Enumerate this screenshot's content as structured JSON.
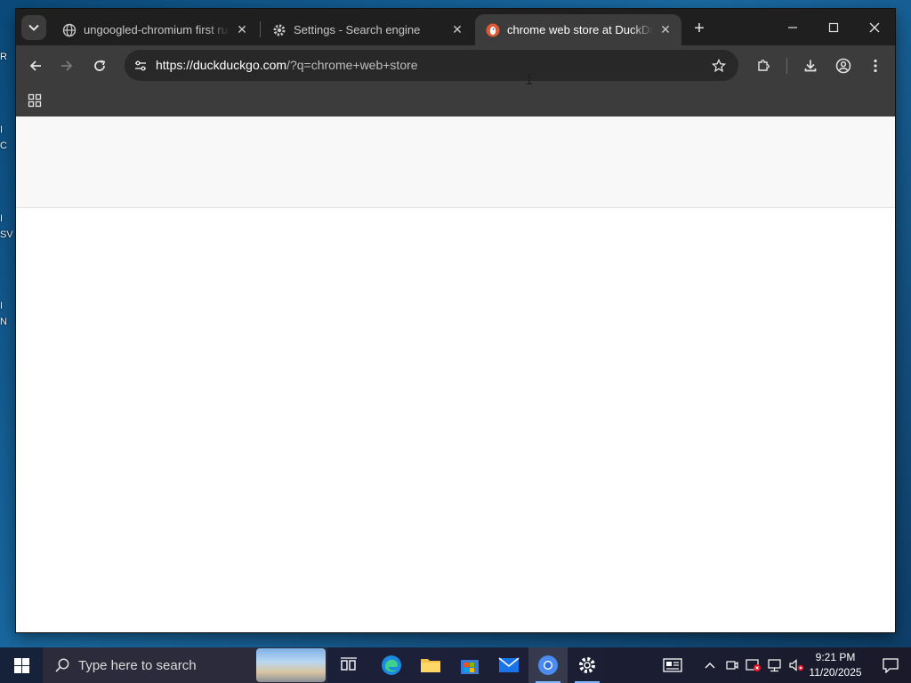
{
  "desktop": {
    "icon_fragments": [
      "R",
      "I",
      "C",
      "I",
      "SV",
      "I",
      "N"
    ]
  },
  "browser": {
    "tabs": [
      {
        "title": "ungoogled-chromium first run p",
        "favicon": "globe-icon",
        "active": false
      },
      {
        "title": "Settings - Search engine",
        "favicon": "gear-icon",
        "active": false
      },
      {
        "title": "chrome web store at DuckDuckGo",
        "favicon": "duckduckgo-icon",
        "active": true
      }
    ],
    "new_tab_label": "+",
    "address_bar": {
      "url_host": "https://duckduckgo.com",
      "url_path": "/?q=chrome+web+store"
    },
    "colors": {
      "tabstrip": "#1f1f1f",
      "toolbar": "#3c3c3c",
      "omnibox": "#282828",
      "content_header": "#f8f8f8",
      "ddg_red": "#de5833"
    }
  },
  "taskbar": {
    "search_placeholder": "Type here to search",
    "apps": [
      "task-view-icon",
      "edge-icon",
      "file-explorer-icon",
      "store-icon",
      "mail-icon",
      "chromium-icon",
      "settings-icon"
    ],
    "clock": {
      "time": "9:21 PM",
      "date": "11/20/2025"
    }
  }
}
